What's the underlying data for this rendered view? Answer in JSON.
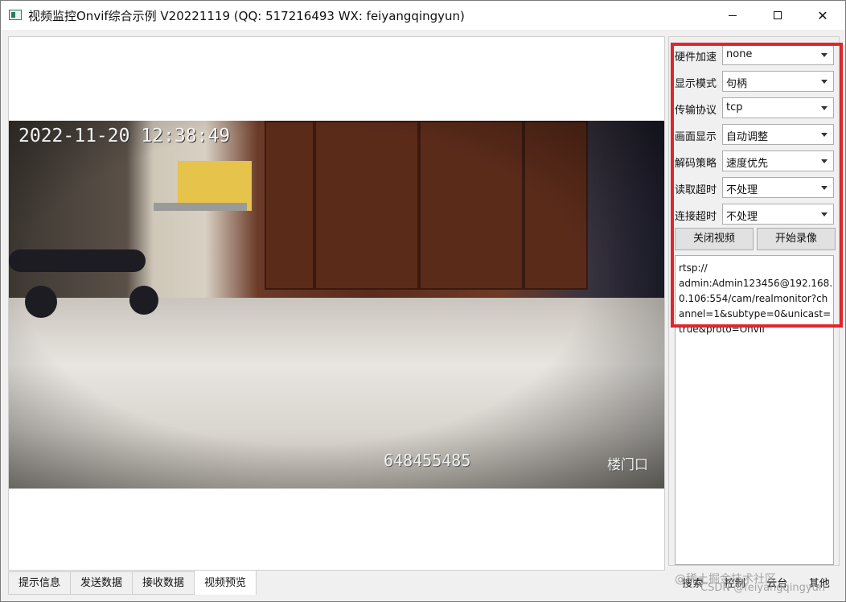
{
  "window": {
    "title": "视频监控Onvif综合示例 V20221119 (QQ: 517216493 WX: feiyangqingyun)",
    "close_glyph": "✕"
  },
  "video": {
    "timestamp": "2022-11-20 12:38:49",
    "device_id": "648455485",
    "location": "楼门口"
  },
  "settings": [
    {
      "label": "硬件加速",
      "value": "none"
    },
    {
      "label": "显示模式",
      "value": "句柄"
    },
    {
      "label": "传输协议",
      "value": "tcp"
    },
    {
      "label": "画面显示",
      "value": "自动调整"
    },
    {
      "label": "解码策略",
      "value": "速度优先"
    },
    {
      "label": "读取超时",
      "value": "不处理"
    },
    {
      "label": "连接超时",
      "value": "不处理"
    }
  ],
  "buttons": {
    "close_video": "关闭视频",
    "start_record": "开始录像"
  },
  "url": "rtsp://\nadmin:Admin123456@192.168.0.106:554/cam/realmonitor?channel=1&subtype=0&unicast=true&proto=Onvif",
  "tabs": [
    "提示信息",
    "发送数据",
    "接收数据",
    "视频预览"
  ],
  "active_tab": "视频预览",
  "bottom_buttons": [
    "搜索",
    "控制",
    "云台",
    "其他"
  ],
  "watermark": {
    "line1": "@稀土掘金技术社区",
    "line2": "CSDN @feiyangqingyun"
  },
  "colors": {
    "highlight": "#e0262b"
  }
}
